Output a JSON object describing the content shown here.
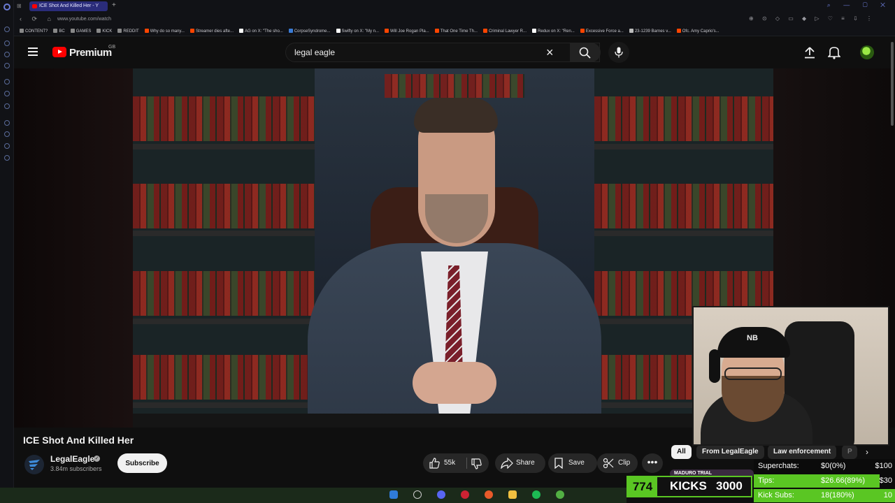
{
  "browser": {
    "active_tab_title": "ICE Shot And Killed Her - Y",
    "url": "www.youtube.com/watch",
    "bookmarks": [
      {
        "label": "CONTENT?",
        "color": "#888888"
      },
      {
        "label": "BC",
        "color": "#888888"
      },
      {
        "label": "GAMES",
        "color": "#888888"
      },
      {
        "label": "KICK",
        "color": "#888888"
      },
      {
        "label": "REDDIT",
        "color": "#888888"
      },
      {
        "label": "Why do so many...",
        "color": "#ff4500"
      },
      {
        "label": "Streamer dies afte...",
        "color": "#ff4500"
      },
      {
        "label": "AG on X: \"The sho...",
        "color": "#ffffff"
      },
      {
        "label": "CorpseSyndrome...",
        "color": "#3a7bd5"
      },
      {
        "label": "Swifty on X: \"My n...",
        "color": "#ffffff"
      },
      {
        "label": "Will Joe Rogan Pla...",
        "color": "#ff4500"
      },
      {
        "label": "That One Time Th...",
        "color": "#ff4500"
      },
      {
        "label": "Criminal Lawyer R...",
        "color": "#ff4500"
      },
      {
        "label": "Redux on X: \"Ren...",
        "color": "#ffffff"
      },
      {
        "label": "Excessive Force a...",
        "color": "#ff4500"
      },
      {
        "label": "23-1239 Barnes v...",
        "color": "#bbbbbb"
      },
      {
        "label": "Ofc. Amy Caprio's...",
        "color": "#ff4500"
      }
    ]
  },
  "masthead": {
    "logo_text": "Premium",
    "region": "GB",
    "search_value": "legal eagle",
    "icons": [
      "menu-icon",
      "search-icon",
      "mic-icon",
      "upload-icon",
      "bell-icon"
    ]
  },
  "video": {
    "title": "ICE Shot And Killed Her",
    "channel_name": "LegalEagle",
    "subscribers": "3.84m subscribers",
    "subscribe_label": "Subscribe",
    "likes": "55k",
    "share_label": "Share",
    "save_label": "Save",
    "clip_label": "Clip",
    "more_label": "•••"
  },
  "chips": [
    "All",
    "From LegalEagle",
    "Law enforcement",
    "P"
  ],
  "overlay": {
    "webcam_hat_logo": "NB",
    "maduro_tag": "MADURO TRIAL",
    "kicks_count": "774",
    "kicks_label": "KICKS",
    "kicks_goal": "3000",
    "goals": [
      {
        "label": "Superchats:",
        "value": "$0(0%)",
        "target": "$100",
        "fraction": 0.0
      },
      {
        "label": "Tips:",
        "value": "$26.66(89%)",
        "target": "$30",
        "fraction": 0.89
      },
      {
        "label": "Kick Subs:",
        "value": "18(180%)",
        "target": "10",
        "fraction": 1.0
      }
    ]
  },
  "colors": {
    "yt_red": "#ff0000",
    "kick_green": "#5ac623",
    "background": "#0f0f0f"
  }
}
